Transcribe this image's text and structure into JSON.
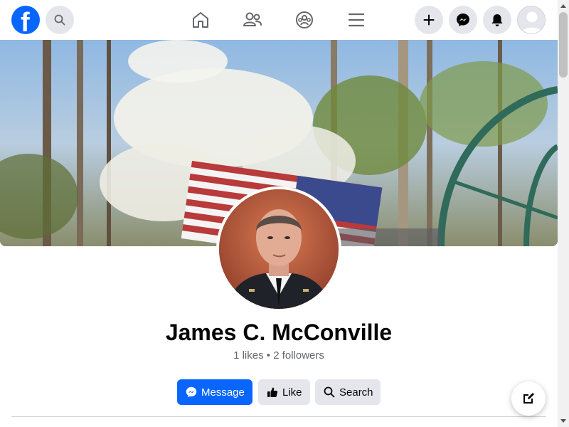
{
  "topbar": {
    "logo_letter": "f",
    "icons": {
      "search": "search-icon",
      "home": "home-icon",
      "friends": "friends-icon",
      "groups": "groups-icon",
      "menu": "menu-icon",
      "create": "plus-icon",
      "messenger": "messenger-icon",
      "notifications": "bell-icon",
      "account": "avatar"
    }
  },
  "profile": {
    "name": "James C. McConville",
    "stats": "1 likes • 2 followers"
  },
  "actions": {
    "message_label": "Message",
    "like_label": "Like",
    "search_label": "Search"
  },
  "colors": {
    "brand": "#0866ff",
    "secondary_button": "#e4e6eb",
    "muted_text": "#65676b"
  }
}
